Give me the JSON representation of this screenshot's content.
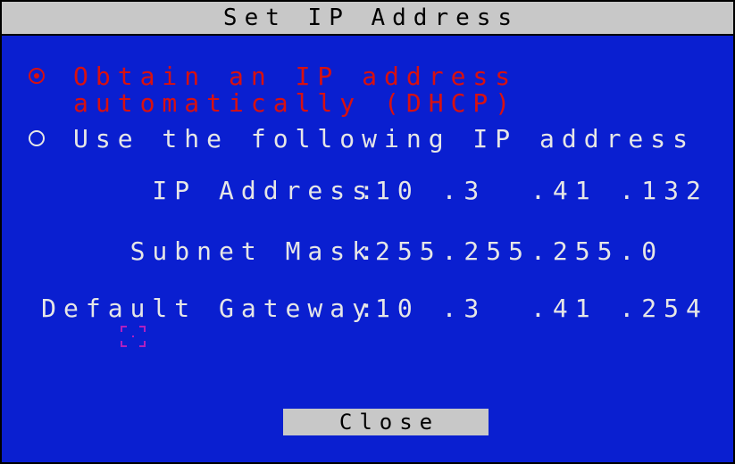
{
  "dialog": {
    "title": "Set IP Address",
    "options": {
      "dhcp_line1": "Obtain an IP address",
      "dhcp_line2": "automatically (DHCP)",
      "static_label": "Use the following IP address"
    },
    "fields": {
      "ip_address": {
        "label": "IP Address",
        "value": "10 .3  .41 .132"
      },
      "subnet_mask": {
        "label": "Subnet Mask",
        "value": "255.255.255.0"
      },
      "default_gateway": {
        "label": "Default Gateway",
        "value": "10 .3  .41 .254"
      }
    },
    "close_label": "Close",
    "colors": {
      "background": "#0a1fd0",
      "titlebar": "#c8c8c8",
      "selected_option": "#d81010",
      "text": "#e6e6e6",
      "cursor": "#b020c0"
    }
  }
}
